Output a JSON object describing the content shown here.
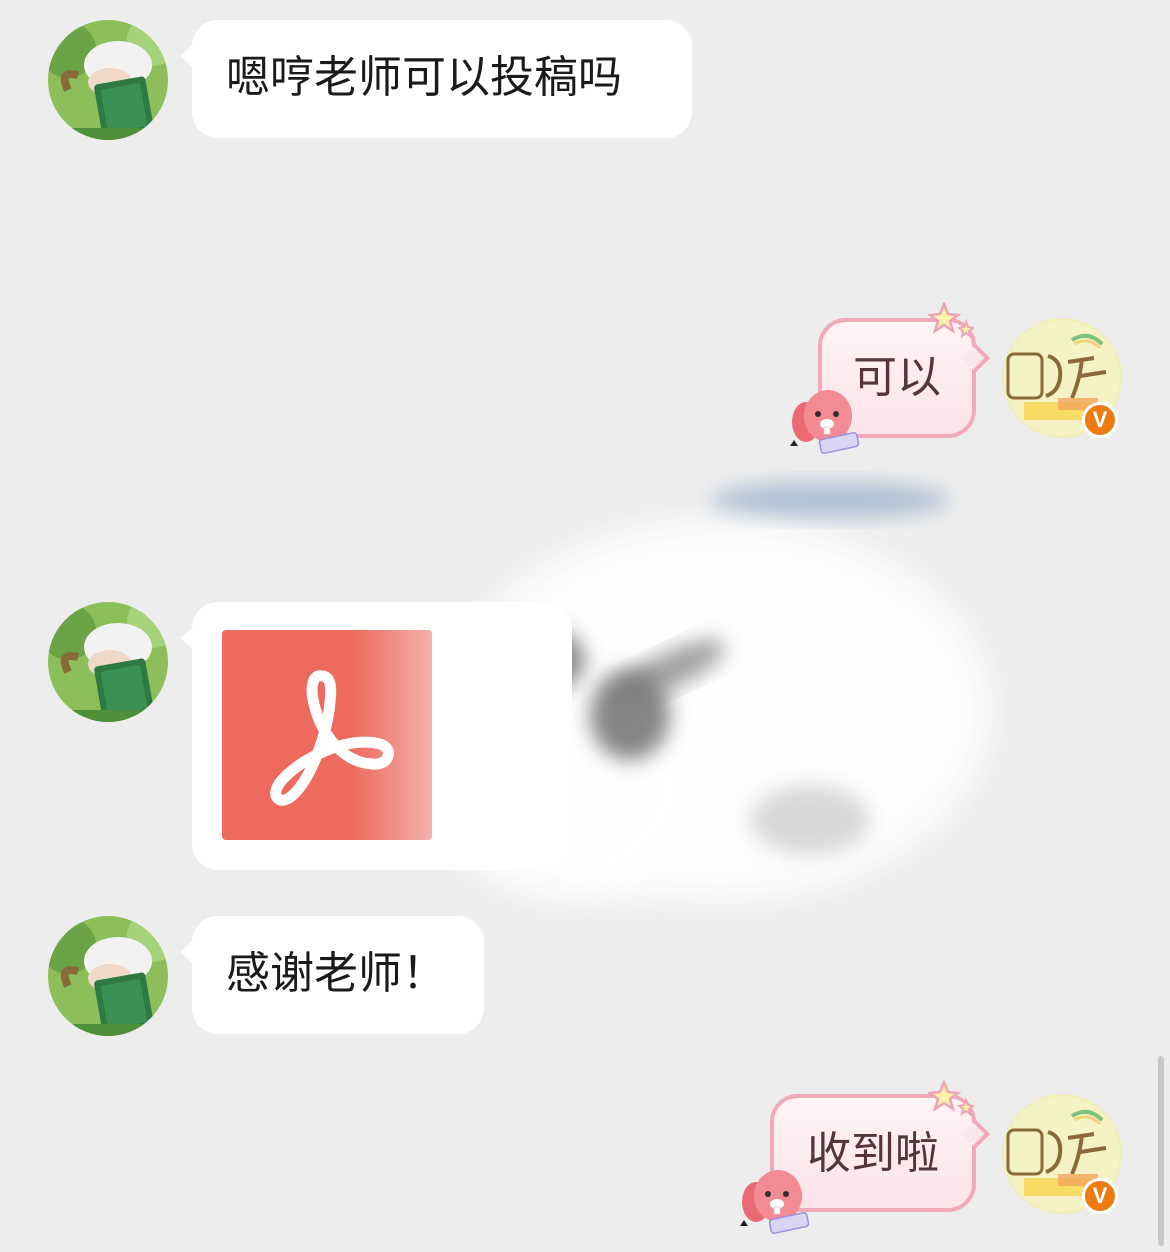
{
  "messages": [
    {
      "side": "left",
      "text": "嗯哼老师可以投稿吗"
    },
    {
      "side": "right",
      "text": "可以"
    },
    {
      "side": "left",
      "type": "file",
      "file_kind": "pdf-icon"
    },
    {
      "side": "left",
      "text": "感谢老师！"
    },
    {
      "side": "right",
      "text": "收到啦"
    }
  ],
  "self_badge": "V",
  "colors": {
    "background": "#ededed",
    "left_bubble": "#ffffff",
    "right_bubble_border": "#f2a9ba",
    "pdf_red": "#ee6a5f",
    "badge_orange": "#f07a12"
  }
}
